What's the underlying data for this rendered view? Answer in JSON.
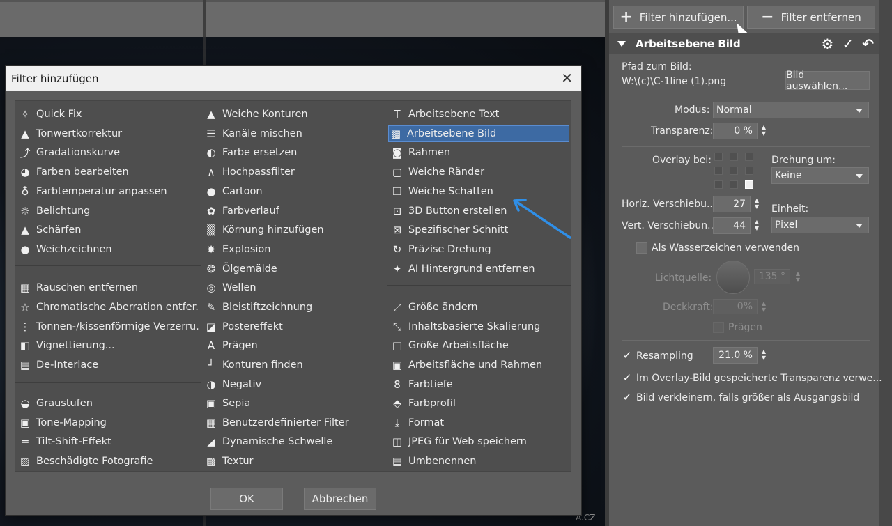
{
  "canvas": {
    "watermark": "A.CZ"
  },
  "panel": {
    "add_filter_label": "Filter hinzufügen...",
    "remove_filter_label": "Filter entfernen",
    "filter_title": "Arbeitsebene Bild",
    "path_label": "Pfad zum Bild:",
    "path_value": "W:\\(c)\\C-1line (1).png",
    "choose_image_label": "Bild auswählen...",
    "mode_label": "Modus:",
    "mode_value": "Normal",
    "transparency_label": "Transparenz:",
    "transparency_value": "0 %",
    "overlay_label": "Overlay bei:",
    "rotation_label": "Drehung um:",
    "rotation_value": "Keine",
    "hshift_label": "Horiz. Verschiebu...",
    "hshift_value": "27",
    "vshift_label": "Vert. Verschiebun...",
    "vshift_value": "44",
    "unit_label": "Einheit:",
    "unit_value": "Pixel",
    "watermark_label": "Als Wasserzeichen verwenden",
    "light_label": "Lichtquelle:",
    "light_value": "135 °",
    "opacity_label": "Deckkraft:",
    "opacity_value": "0%",
    "emboss_label": "Prägen",
    "resampling_label": "Resampling",
    "resampling_value": "21.0 %",
    "overlay_transparency_label": "Im Overlay-Bild gespeicherte Transparenz verwe...",
    "shrink_label": "Bild verkleinern, falls größer als Ausgangsbild"
  },
  "dialog": {
    "title": "Filter hinzufügen",
    "ok_label": "OK",
    "cancel_label": "Abbrechen",
    "col1": [
      {
        "label": "Quick Fix",
        "icon": "✧"
      },
      {
        "label": "Tonwertkorrektur",
        "icon": "▲"
      },
      {
        "label": "Gradationskurve",
        "icon": "⤴"
      },
      {
        "label": "Farben bearbeiten",
        "icon": "◕"
      },
      {
        "label": "Farbtemperatur anpassen",
        "icon": "♁"
      },
      {
        "label": "Belichtung",
        "icon": "☼"
      },
      {
        "label": "Schärfen",
        "icon": "▲"
      },
      {
        "label": "Weichzeichnen",
        "icon": "●"
      },
      {
        "label": "Rauschen entfernen",
        "icon": "▦"
      },
      {
        "label": "Chromatische Aberration entfer...",
        "icon": "☆"
      },
      {
        "label": "Tonnen-/kissenförmige Verzerru...",
        "icon": "⋮"
      },
      {
        "label": "Vignettierung...",
        "icon": "◧"
      },
      {
        "label": "De-Interlace",
        "icon": "▤"
      },
      {
        "label": "Graustufen",
        "icon": "◒"
      },
      {
        "label": "Tone-Mapping",
        "icon": "▣"
      },
      {
        "label": "Tilt-Shift-Effekt",
        "icon": "═"
      },
      {
        "label": "Beschädigte Fotografie",
        "icon": "▨"
      }
    ],
    "col2": [
      {
        "label": "Weiche Konturen",
        "icon": "▲"
      },
      {
        "label": "Kanäle mischen",
        "icon": "☰"
      },
      {
        "label": "Farbe ersetzen",
        "icon": "◐"
      },
      {
        "label": "Hochpassfilter",
        "icon": "∧"
      },
      {
        "label": "Cartoon",
        "icon": "●"
      },
      {
        "label": "Farbverlauf",
        "icon": "✿"
      },
      {
        "label": "Körnung hinzufügen",
        "icon": "▒"
      },
      {
        "label": "Explosion",
        "icon": "✸"
      },
      {
        "label": "Ölgemälde",
        "icon": "❂"
      },
      {
        "label": "Wellen",
        "icon": "◎"
      },
      {
        "label": "Bleistiftzeichnung",
        "icon": "✎"
      },
      {
        "label": "Postereffekt",
        "icon": "◪"
      },
      {
        "label": "Prägen",
        "icon": "A"
      },
      {
        "label": "Konturen finden",
        "icon": "┘"
      },
      {
        "label": "Negativ",
        "icon": "◑"
      },
      {
        "label": "Sepia",
        "icon": "▣"
      },
      {
        "label": "Benutzerdefinierter Filter",
        "icon": "▦"
      },
      {
        "label": "Dynamische Schwelle",
        "icon": "◢"
      },
      {
        "label": "Textur",
        "icon": "▩"
      }
    ],
    "col3": [
      {
        "label": "Arbeitsebene Text",
        "icon": "T"
      },
      {
        "label": "Arbeitsebene Bild",
        "icon": "▩"
      },
      {
        "label": "Rahmen",
        "icon": "◙"
      },
      {
        "label": "Weiche Ränder",
        "icon": "▢"
      },
      {
        "label": "Weiche Schatten",
        "icon": "❐"
      },
      {
        "label": "3D Button erstellen",
        "icon": "⊡"
      },
      {
        "label": "Spezifischer Schnitt",
        "icon": "⊠"
      },
      {
        "label": "Präzise Drehung",
        "icon": "↻"
      },
      {
        "label": "AI Hintergrund entfernen",
        "icon": "✦"
      },
      {
        "label": "Größe ändern",
        "icon": "⤢"
      },
      {
        "label": "Inhaltsbasierte Skalierung",
        "icon": "⤡"
      },
      {
        "label": "Größe Arbeitsfläche",
        "icon": "□"
      },
      {
        "label": "Arbeitsfläche und Rahmen",
        "icon": "▣"
      },
      {
        "label": "Farbtiefe",
        "icon": "8"
      },
      {
        "label": "Farbprofil",
        "icon": "⬘"
      },
      {
        "label": "Format",
        "icon": "⤓"
      },
      {
        "label": "JPEG für Web speichern",
        "icon": "◫"
      },
      {
        "label": "Umbenennen",
        "icon": "▤"
      }
    ]
  }
}
